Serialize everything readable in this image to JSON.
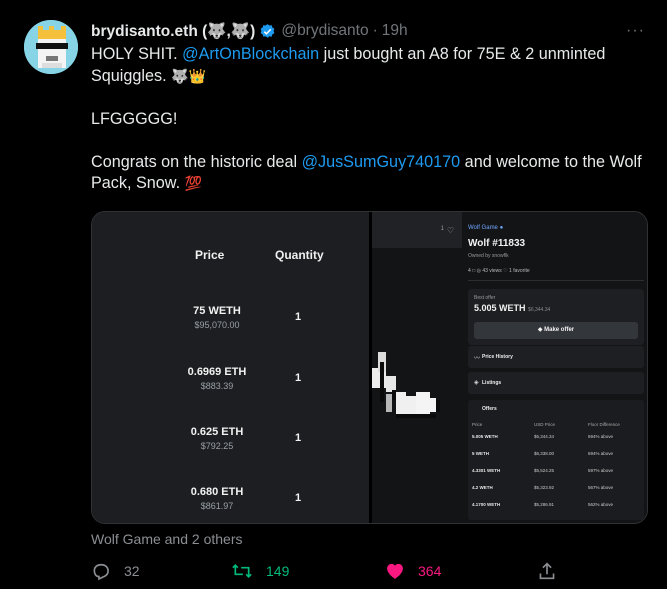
{
  "tweet": {
    "display_name": "brydisanto.eth (🐺,🐺)",
    "handle": "@brydisanto",
    "dot": "·",
    "time": "19h",
    "more_glyph": "···",
    "line1_a": "HOLY SHIT. ",
    "line1_mention": "@ArtOnBlockchain",
    "line1_b": " just bought an A8 for 75E & 2 unminted Squiggles. ",
    "line1_emoji": "🐺👑",
    "line2": "LFGGGGG!",
    "line3_a": "Congrats on the historic deal ",
    "line3_mention": "@JusSumGuy740170",
    "line3_b": " and welcome to the Wolf Pack, Snow. ",
    "line3_emoji": "💯",
    "footer_note": "Wolf Game and 2 others",
    "actions": {
      "replies": "32",
      "retweets": "149",
      "likes": "364"
    }
  },
  "media": {
    "left_table": {
      "headers": {
        "price": "Price",
        "quantity": "Quantity"
      },
      "rows": [
        {
          "price": "75 WETH",
          "usd": "$95,070.00",
          "qty": "1"
        },
        {
          "price": "0.6969 ETH",
          "usd": "$883.39",
          "qty": "1"
        },
        {
          "price": "0.625 ETH",
          "usd": "$792.25",
          "qty": "1"
        },
        {
          "price": "0.680 ETH",
          "usd": "$861.97",
          "qty": "1"
        }
      ]
    },
    "right_panel": {
      "fav_count": "1",
      "fav_glyph": "♡",
      "collection": "Wolf Game ●",
      "title": "Wolf #11833",
      "owned_by": "Owned by snowflk",
      "stats": "4 □     ◎ 43 views     ♡ 1 favorite",
      "best_offer_label": "Best offer",
      "best_offer_value": "5.005 WETH",
      "best_offer_usd": "$6,344.34",
      "make_offer": "◆  Make offer",
      "price_history": "Price History",
      "listings": "Listings",
      "offers_title": "Offers",
      "offer_headers": {
        "price": "Price",
        "usd": "USD Price",
        "floor": "Floor Difference"
      },
      "offers": [
        {
          "price": "5.005 WETH",
          "usd": "$6,344.34",
          "floor": "694% above"
        },
        {
          "price": "5 WETH",
          "usd": "$6,338.00",
          "floor": "694% above"
        },
        {
          "price": "4.3301 WETH",
          "usd": "$5,524.25",
          "floor": "597% above"
        },
        {
          "price": "4.2 WETH",
          "usd": "$5,323.92",
          "floor": "567% above"
        },
        {
          "price": "4.1700 WETH",
          "usd": "$5,286.91",
          "floor": "562% above"
        }
      ]
    }
  },
  "colors": {
    "background": "#000000",
    "link": "#1d9bf0",
    "retweet": "#00ba7c",
    "like": "#f91880",
    "muted": "#71767b"
  },
  "icons": [
    "verified-badge-icon",
    "more-icon",
    "reply-icon",
    "retweet-icon",
    "heart-icon",
    "share-icon",
    "heart-outline-icon"
  ]
}
